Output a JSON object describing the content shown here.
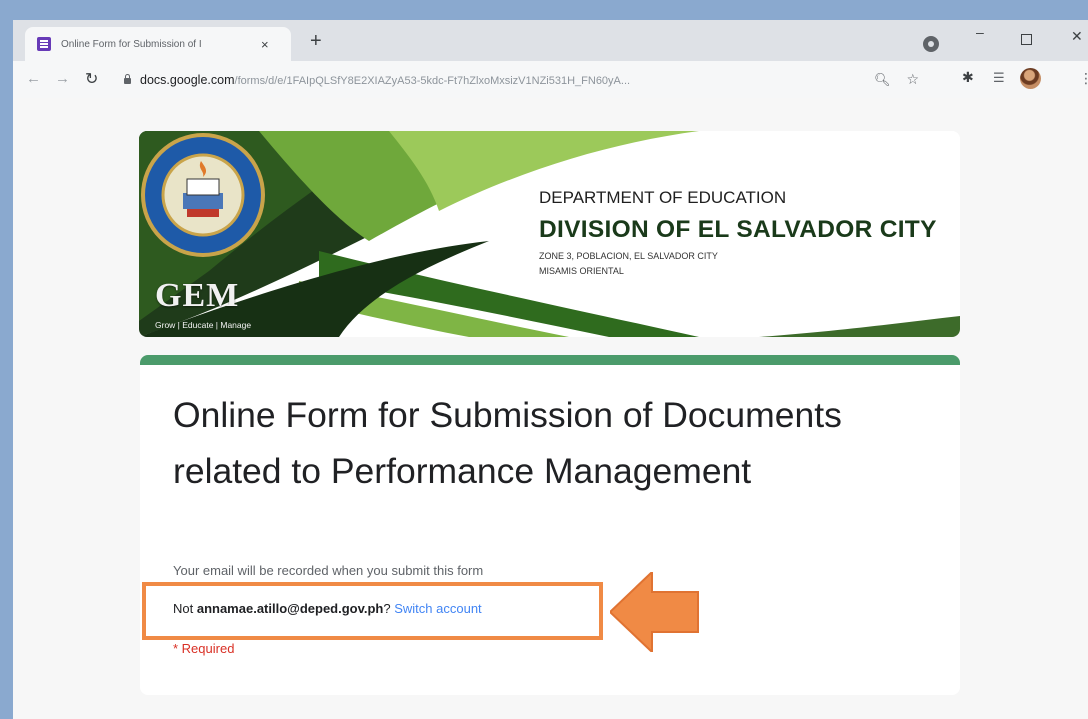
{
  "browser": {
    "tab_title": "Online Form for Submission of I",
    "tab_close": "×",
    "new_tab": "+",
    "url_host": "docs.google.com",
    "url_path": "/forms/d/e/1FAIpQLSfY8E2XIAZyA53-5kdc-Ft7hZlxoMxsizV1NZi531H_FN60yA...",
    "window_controls": {
      "minimize": "–",
      "close": "✕"
    }
  },
  "banner": {
    "department": "DEPARTMENT OF EDUCATION",
    "division": "DIVISION OF EL SALVADOR CITY",
    "address_line1": "ZONE 3, POBLACION, EL SALVADOR CITY",
    "address_line2": "MISAMIS ORIENTAL",
    "gem_logo": "GEM",
    "gem_tagline": "Grow | Educate | Manage",
    "seal_text": "DIVISION OF EL SALVADOR CITY"
  },
  "form": {
    "title": "Online Form for Submission of Documents related to Performance Management",
    "email_note": "Your email will be recorded when you submit this form",
    "not_prefix": "Not ",
    "account_email": "annamae.atillo@deped.gov.ph",
    "question_mark": "?",
    "switch_account": "Switch account",
    "required_note": "* Required"
  },
  "colors": {
    "accent_green": "#4b9b6b",
    "highlight_orange": "#f08a45",
    "link_blue": "#4285f4",
    "required_red": "#d93025"
  },
  "icons": [
    "forms-favicon",
    "chrome-icon",
    "back-arrow-icon",
    "forward-arrow-icon",
    "reload-icon",
    "lock-icon",
    "zoom-icon",
    "star-icon",
    "extensions-icon",
    "reading-list-icon",
    "avatar",
    "menu-icon",
    "arrow-pointer-icon"
  ]
}
